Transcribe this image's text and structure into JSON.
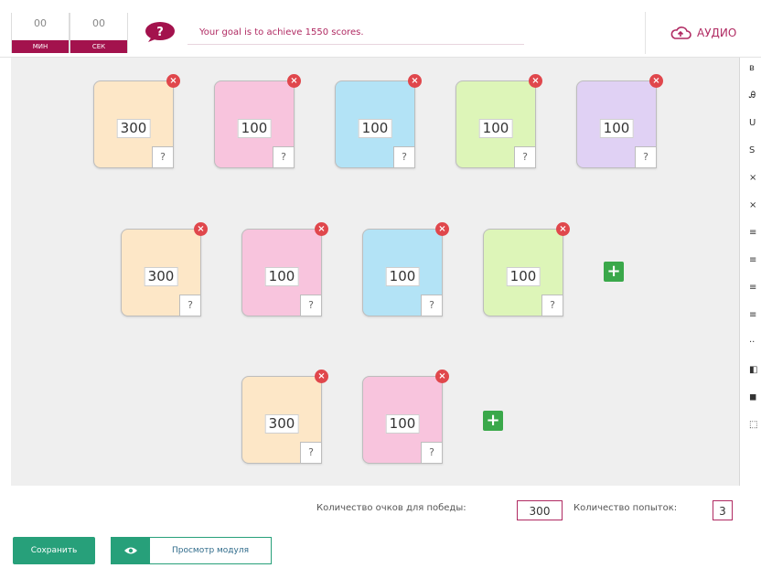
{
  "header": {
    "timer": {
      "minutes": "00",
      "minutes_label": "МИН",
      "seconds": "00",
      "seconds_label": "СЕК"
    },
    "goal_text": "Your goal is to achieve 1550 scores.",
    "audio_label": "АУДИО"
  },
  "board": {
    "rows": [
      [
        {
          "value": "300",
          "color": "#fde7c7"
        },
        {
          "value": "100",
          "color": "#f8c4dd"
        },
        {
          "value": "100",
          "color": "#b3e3f6"
        },
        {
          "value": "100",
          "color": "#ddf5b8"
        },
        {
          "value": "100",
          "color": "#e0d1f4"
        }
      ],
      [
        {
          "value": "300",
          "color": "#fde7c7"
        },
        {
          "value": "100",
          "color": "#f8c4dd"
        },
        {
          "value": "100",
          "color": "#b3e3f6"
        },
        {
          "value": "100",
          "color": "#ddf5b8"
        }
      ],
      [
        {
          "value": "300",
          "color": "#fde7c7"
        },
        {
          "value": "100",
          "color": "#f8c4dd"
        }
      ]
    ],
    "question_mark": "?",
    "delete_symbol": "×",
    "add_symbol": "+"
  },
  "toolbar": {
    "items": [
      "в",
      "Ꭿ",
      "U",
      "Ѕ",
      "×",
      "×",
      "≡",
      "≡",
      "≡",
      "≡",
      "··",
      "◧",
      "◼",
      "⬚"
    ]
  },
  "footer": {
    "win_label": "Количество очков для победы:",
    "win_value": "300",
    "attempts_label": "Количество попыток:",
    "attempts_value": "3",
    "save_label": "Сохранить",
    "preview_label": "Просмотр модуля"
  },
  "colors": {
    "accent": "#b02a62",
    "green": "#27a07a",
    "delete": "#e0474c"
  }
}
